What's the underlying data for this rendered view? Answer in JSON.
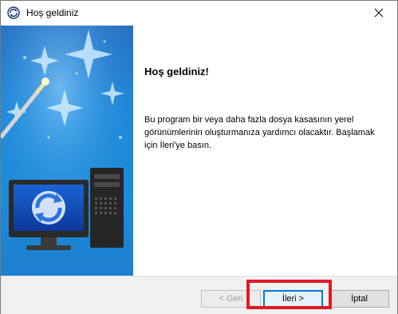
{
  "window": {
    "title": "Hoş geldiniz"
  },
  "content": {
    "heading": "Hoş geldiniz!",
    "description": "Bu program bir veya daha fazla dosya kasasının yerel görünümlerinin oluşturmanıza yardımcı olacaktır. Başlamak için İleri'ye basın."
  },
  "buttons": {
    "back": "< Geri",
    "next": "İleri >",
    "cancel": "İptal"
  },
  "colors": {
    "accent": "#0078d7",
    "highlight": "#e01b24",
    "panel": "#1c8bd9"
  },
  "icons": [
    "app-sync-icon",
    "close-icon",
    "magic-wand-icon",
    "computer-sync-icon"
  ]
}
